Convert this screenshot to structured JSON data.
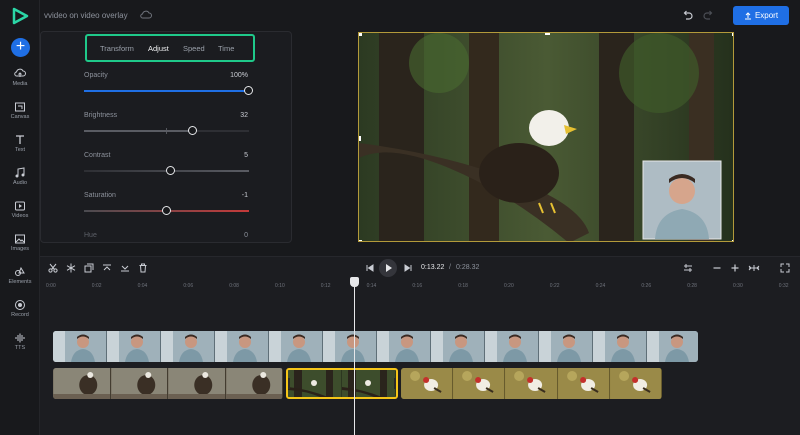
{
  "app": {
    "project_title": "vvideo on video overlay",
    "export_label": "Export"
  },
  "rail": [
    {
      "icon": "media-icon",
      "label": "Media"
    },
    {
      "icon": "canvas-icon",
      "label": "Canvas"
    },
    {
      "icon": "text-icon",
      "label": "Text"
    },
    {
      "icon": "audio-icon",
      "label": "Audio"
    },
    {
      "icon": "videos-icon",
      "label": "Videos"
    },
    {
      "icon": "images-icon",
      "label": "Images"
    },
    {
      "icon": "elements-icon",
      "label": "Elements"
    },
    {
      "icon": "record-icon",
      "label": "Record"
    },
    {
      "icon": "tts-icon",
      "label": "TTS"
    }
  ],
  "panel": {
    "tabs": [
      "Transform",
      "Adjust",
      "Speed",
      "Time"
    ],
    "active_tab": "Adjust",
    "rows": [
      {
        "label": "Opacity",
        "value": "100%",
        "level": 1.0
      },
      {
        "label": "Brightness",
        "value": "32",
        "level": 0.66
      },
      {
        "label": "Contrast",
        "value": "5",
        "level": 0.53
      },
      {
        "label": "Saturation",
        "value": "-1",
        "level": 0.5
      },
      {
        "label": "Hue",
        "value": "0",
        "level": 0.5
      }
    ]
  },
  "timeline": {
    "current_time": "0:13.22",
    "separator": "/",
    "total_time": "0:28.32",
    "ruler": [
      "0:00",
      "0:02",
      "0:04",
      "0:06",
      "0:08",
      "0:10",
      "0:12",
      "0:14",
      "0:16",
      "0:18",
      "0:20",
      "0:22",
      "0:24",
      "0:26",
      "0:28",
      "0:30",
      "0:32"
    ]
  },
  "colors": {
    "accent": "#1f6fe5",
    "highlight": "#1fc98a",
    "selection": "#f5c518",
    "opacity_track": "#1f6fe5",
    "saturation_track": "#c53a3a"
  }
}
